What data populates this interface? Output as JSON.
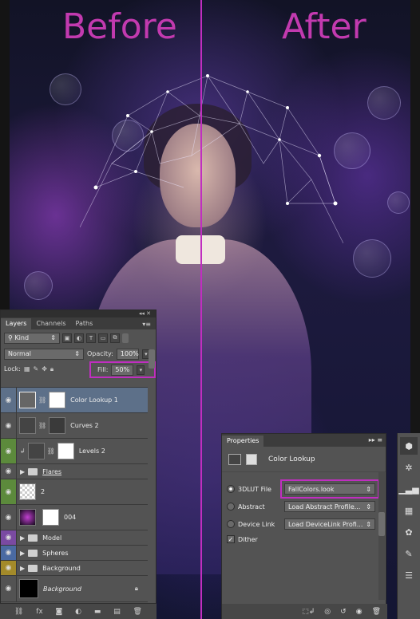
{
  "artwork": {
    "before_label": "Before",
    "after_label": "After",
    "label_color": "#c23aaf",
    "divider_color": "#c02ec0"
  },
  "layers_panel": {
    "tabs": [
      "Layers",
      "Channels",
      "Paths"
    ],
    "kind_label": "Kind",
    "blend_mode": "Normal",
    "opacity_label": "Opacity:",
    "opacity_value": "100%",
    "lock_label": "Lock:",
    "fill_label": "Fill:",
    "fill_value": "50%",
    "layers": [
      {
        "name": "Color Lookup 1",
        "type": "adjustment",
        "selected": true
      },
      {
        "name": "Curves 2",
        "type": "adjustment"
      },
      {
        "name": "Levels 2",
        "type": "adjustment"
      },
      {
        "name": "Flares",
        "type": "group"
      },
      {
        "name": "2",
        "type": "pixel"
      },
      {
        "name": "004",
        "type": "pixel"
      },
      {
        "name": "Model",
        "type": "group"
      },
      {
        "name": "Spheres",
        "type": "group"
      },
      {
        "name": "Background",
        "type": "group"
      },
      {
        "name": "Background",
        "type": "background"
      }
    ],
    "eye_colors": [
      "",
      "",
      "#5c8a3c",
      "",
      "#5c8a3c",
      "",
      "#7a4aa2",
      "#4a6aa2",
      "#a38a2a",
      ""
    ]
  },
  "properties_panel": {
    "tab": "Properties",
    "title": "Color Lookup",
    "options": [
      {
        "label": "3DLUT File",
        "value": "FallColors.look",
        "selected": true
      },
      {
        "label": "Abstract",
        "value": "Load Abstract Profile...",
        "selected": false
      },
      {
        "label": "Device Link",
        "value": "Load DeviceLink Profi...",
        "selected": false
      }
    ],
    "dither_label": "Dither",
    "dither_checked": true
  },
  "highlight_color": "#c02ec0"
}
